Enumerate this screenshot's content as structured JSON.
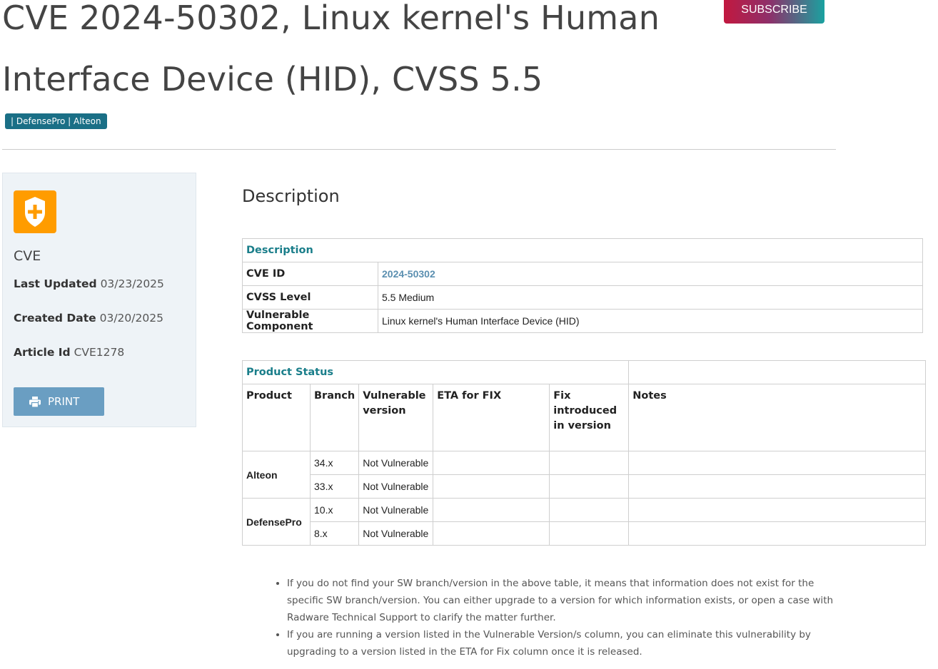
{
  "page": {
    "title": "CVE 2024-50302, Linux kernel's Human Interface Device (HID), CVSS 5.5",
    "subscribe_label": "SUBSCRIBE",
    "tags": "| DefensePro | Alteon"
  },
  "sidebar": {
    "icon": "shield-plus-icon",
    "type": "CVE",
    "last_updated_label": "Last Updated",
    "last_updated": "03/23/2025",
    "created_label": "Created Date",
    "created": "03/20/2025",
    "article_label": "Article Id",
    "article_id": "CVE1278",
    "print_label": "PRINT",
    "print_icon": "printer-icon"
  },
  "main": {
    "section_title": "Description",
    "description_table": {
      "header": "Description",
      "rows": [
        {
          "label": "CVE ID",
          "value": "2024-50302"
        },
        {
          "label": "CVSS Level",
          "value": "5.5 Medium"
        },
        {
          "label": "Vulnerable Component",
          "value": "Linux kernel's Human Interface Device (HID)"
        }
      ]
    },
    "product_table": {
      "header": "Product Status",
      "columns": [
        "Product",
        "Branch",
        "Vulnerable version",
        "ETA for FIX",
        "Fix introduced in version",
        "Notes"
      ],
      "groups": [
        {
          "product": "Alteon",
          "rows": [
            {
              "branch": "34.x",
              "vulnerable": "Not Vulnerable",
              "eta": "",
              "fix": "",
              "notes": ""
            },
            {
              "branch": "33.x",
              "vulnerable": "Not Vulnerable",
              "eta": "",
              "fix": "",
              "notes": ""
            }
          ]
        },
        {
          "product": "DefensePro",
          "rows": [
            {
              "branch": "10.x",
              "vulnerable": "Not Vulnerable",
              "eta": "",
              "fix": "",
              "notes": ""
            },
            {
              "branch": "8.x",
              "vulnerable": "Not Vulnerable",
              "eta": "",
              "fix": "",
              "notes": ""
            }
          ]
        }
      ]
    },
    "notes": [
      "If you do not find your SW branch/version in the above table, it means that information does not exist for the specific SW branch/version. You can either upgrade to a version for which information exists, or open a case with Radware Technical Support to clarify the matter further.",
      "If you are running a version listed in the Vulnerable Version/s column, you can eliminate this vulnerability by upgrading to a version listed in the ETA for Fix column once it is released."
    ]
  }
}
